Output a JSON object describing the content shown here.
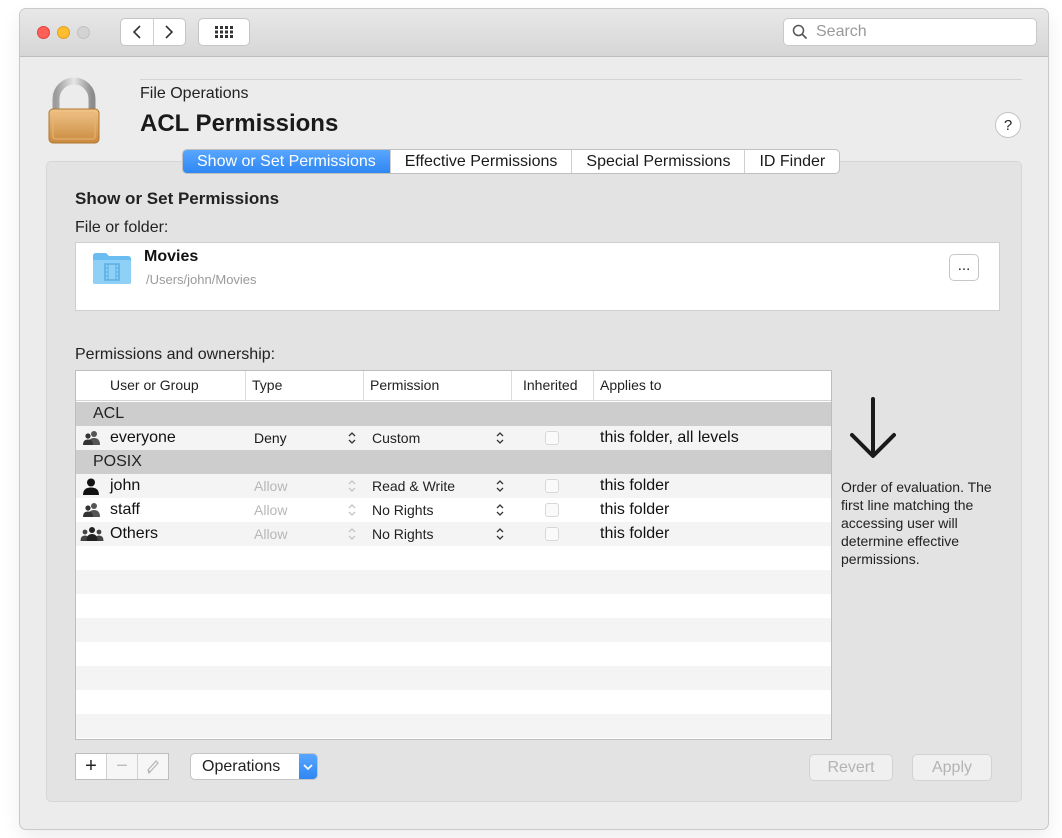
{
  "toolbar": {
    "search_placeholder": "Search"
  },
  "header": {
    "subtitle": "File Operations",
    "title": "ACL Permissions",
    "help_label": "?"
  },
  "tabs": [
    {
      "label": "Show or Set Permissions",
      "active": true
    },
    {
      "label": "Effective Permissions",
      "active": false
    },
    {
      "label": "Special Permissions",
      "active": false
    },
    {
      "label": "ID Finder",
      "active": false
    }
  ],
  "main": {
    "section_title": "Show or Set Permissions",
    "file_label": "File or folder:",
    "file_name": "Movies",
    "file_path": "/Users/john/Movies",
    "more_label": "...",
    "perm_label": "Permissions and ownership:"
  },
  "table": {
    "headers": [
      "User or Group",
      "Type",
      "Permission",
      "Inherited",
      "Applies to"
    ],
    "groups": [
      {
        "label": "ACL",
        "rows": [
          {
            "name": "everyone",
            "icon": "group-icon",
            "type": "Deny",
            "permission": "Custom",
            "inherited": false,
            "applies": "this folder, all levels"
          }
        ]
      },
      {
        "label": "POSIX",
        "rows": [
          {
            "name": "john",
            "icon": "user-icon",
            "type": "Allow",
            "permission": "Read & Write",
            "inherited": false,
            "applies": "this folder"
          },
          {
            "name": "staff",
            "icon": "group-icon",
            "type": "Allow",
            "permission": "No Rights",
            "inherited": false,
            "applies": "this folder"
          },
          {
            "name": "Others",
            "icon": "others-icon",
            "type": "Allow",
            "permission": "No Rights",
            "inherited": false,
            "applies": "this folder"
          }
        ]
      }
    ]
  },
  "note": "Order of evaluation. The first line matching the accessing user will determine effective permissions.",
  "bottom": {
    "add_label": "+",
    "remove_label": "−",
    "operations_label": "Operations",
    "revert_label": "Revert",
    "apply_label": "Apply"
  },
  "colors": {
    "accent": "#2f87f3",
    "window_bg": "#ececec",
    "group_row": "#cdcdcd"
  }
}
